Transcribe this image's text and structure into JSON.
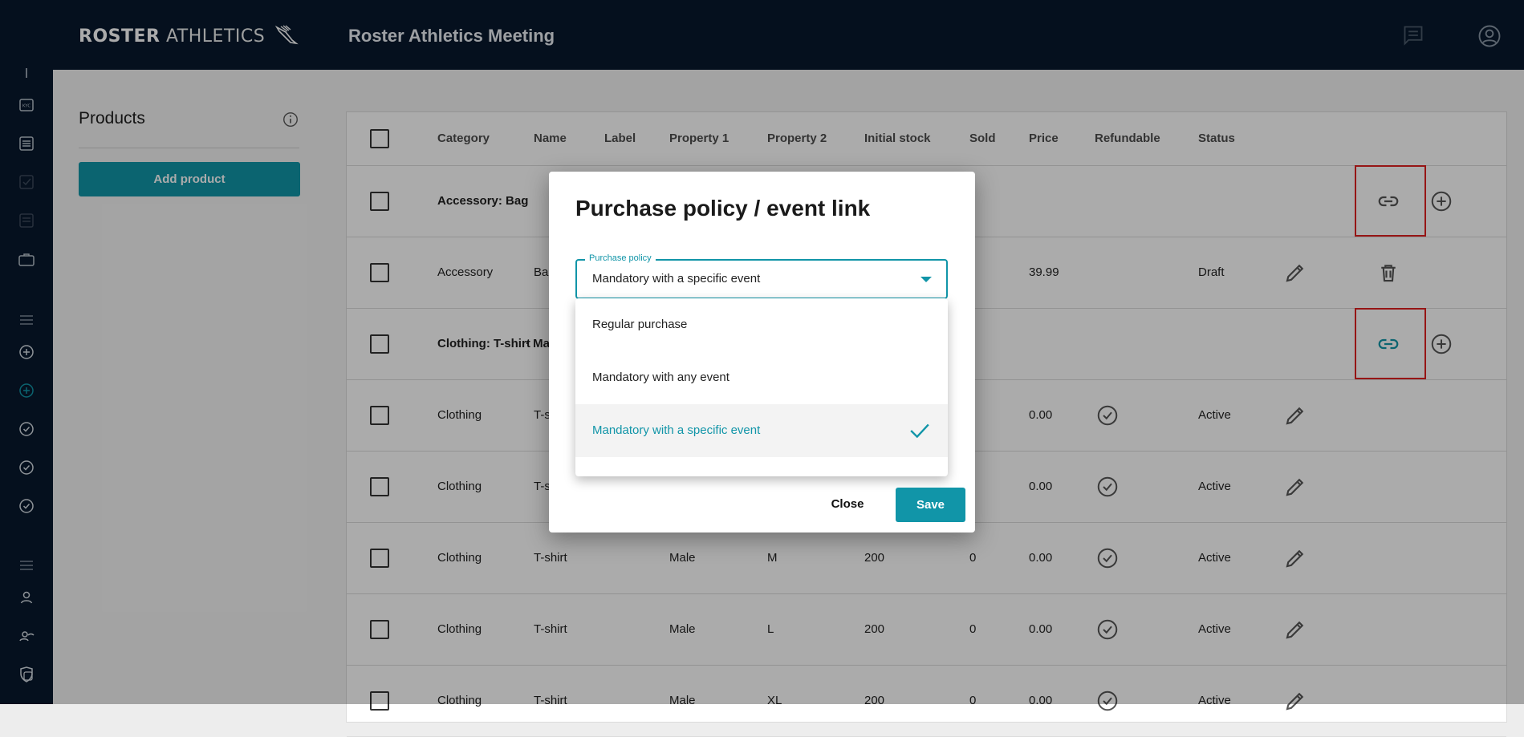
{
  "header": {
    "logo_bold": "ROSTER",
    "logo_light": "ATHLETICS",
    "title": "Roster Athletics Meeting",
    "icons": [
      "chat-icon",
      "account-icon"
    ]
  },
  "sidebar": {
    "icons": [
      "number-icon",
      "kyc-icon",
      "list-icon",
      "checkbox-icon",
      "document-icon",
      "briefcase-icon",
      "menu-icon",
      "add-circle-icon",
      "add-circle-active-icon",
      "check-circle-icon",
      "check-circle-icon",
      "check-circle-icon",
      "menu-icon",
      "person-icon",
      "person-eye-icon",
      "shield-icon"
    ]
  },
  "products_panel": {
    "title": "Products",
    "add_button": "Add product"
  },
  "table": {
    "headers": [
      "Category",
      "Name",
      "Label",
      "Property 1",
      "Property 2",
      "Initial stock",
      "Sold",
      "Price",
      "Refundable",
      "Status"
    ],
    "rows": [
      {
        "category": "Accessory: Bag",
        "name": "",
        "label": "",
        "property1": "",
        "property2": "",
        "initial_stock": "",
        "sold": "",
        "price": "",
        "refundable": false,
        "status": "",
        "group": true
      },
      {
        "category": "Accessory",
        "name": "Ba",
        "label": "",
        "property1": "",
        "property2": "",
        "initial_stock": "",
        "sold": "",
        "price": "39.99",
        "refundable": false,
        "status": "Draft",
        "group": false
      },
      {
        "category": "Clothing: T-shirt",
        "name": "· Ma",
        "label": "",
        "property1": "",
        "property2": "",
        "initial_stock": "",
        "sold": "",
        "price": "",
        "refundable": false,
        "status": "",
        "group": true
      },
      {
        "category": "Clothing",
        "name": "T-s",
        "label": "",
        "property1": "",
        "property2": "",
        "initial_stock": "",
        "sold": "",
        "price": "0.00",
        "refundable": true,
        "status": "Active",
        "group": false
      },
      {
        "category": "Clothing",
        "name": "T-s",
        "label": "",
        "property1": "",
        "property2": "",
        "initial_stock": "",
        "sold": "",
        "price": "0.00",
        "refundable": true,
        "status": "Active",
        "group": false
      },
      {
        "category": "Clothing",
        "name": "T-shirt",
        "label": "",
        "property1": "Male",
        "property2": "M",
        "initial_stock": "200",
        "sold": "0",
        "price": "0.00",
        "refundable": true,
        "status": "Active",
        "group": false
      },
      {
        "category": "Clothing",
        "name": "T-shirt",
        "label": "",
        "property1": "Male",
        "property2": "L",
        "initial_stock": "200",
        "sold": "0",
        "price": "0.00",
        "refundable": true,
        "status": "Active",
        "group": false
      },
      {
        "category": "Clothing",
        "name": "T-shirt",
        "label": "",
        "property1": "Male",
        "property2": "XL",
        "initial_stock": "200",
        "sold": "0",
        "price": "0.00",
        "refundable": true,
        "status": "Active",
        "group": false
      }
    ]
  },
  "dialog": {
    "title": "Purchase policy / event link",
    "select_label": "Purchase policy",
    "select_value": "Mandatory with a specific event",
    "options": [
      "Regular purchase",
      "Mandatory with any event",
      "Mandatory with a specific event"
    ],
    "selected_index": 2,
    "close_label": "Close",
    "save_label": "Save"
  },
  "colors": {
    "accent": "#1195a8",
    "topbar": "#08192d",
    "highlight": "#e02020"
  }
}
